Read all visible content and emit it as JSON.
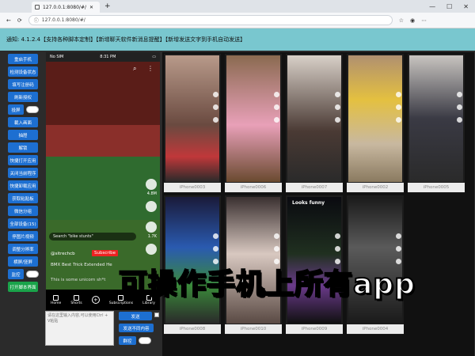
{
  "browser": {
    "tab_title": "127.0.0.1:8080/#/",
    "url": "127.0.0.1:8080/#/"
  },
  "notice": "通知: 4.1.2.4【支持各种脚本定制】【新增聊天软件新消息提醒】【新增发送文字到手机自动发送】",
  "sidebar": {
    "buttons": [
      "重启手机",
      "检测设备状态",
      "填写注册码",
      "刷新授权"
    ],
    "toggle1_label": "投屏",
    "buttons2": [
      "載入画面",
      "抽屉",
      "解锁",
      "快捷打开应用",
      "关闭当前程序",
      "快捷卸载应用",
      "获取粘贴板",
      "微信分组",
      "全部设备(15)",
      "停图片视频",
      "调整分辨率",
      "横屏/竖屏"
    ],
    "toggle2_label": "监控",
    "script_button": "打开脚本界面"
  },
  "main_phone": {
    "time": "8:31 PM",
    "signal": "No SIM",
    "search_text": "Search \"bike stunts\"",
    "user": "@sitrechcb",
    "subscribe": "Subscribe",
    "title": "BMX Best Trick Extended He",
    "desc": "This is some unicorn sh*t",
    "likes": "4.8M",
    "comments": "1.7K",
    "nav": [
      "Home",
      "Shorts",
      "",
      "Subscriptions",
      "Library"
    ]
  },
  "input": {
    "placeholder": "请在这里输入内容,可以使用Ctrl + V粘贴",
    "send": "发送",
    "send_diff": "发送不同内容",
    "group": "群控"
  },
  "phones": [
    {
      "label": "iPhone0003"
    },
    {
      "label": "iPhone0006"
    },
    {
      "label": "iPhone0007"
    },
    {
      "label": "iPhone0002"
    },
    {
      "label": "iPhone0005"
    },
    {
      "label": "iPhone0008"
    },
    {
      "label": "iPhone0010"
    },
    {
      "label": "iPhone0009",
      "looks": "Looks funny"
    },
    {
      "label": "iPhone0004"
    }
  ],
  "overlay_text": "可操作手机上所有app",
  "colors": {
    "blue": "#1d6fd1",
    "notice": "#79c7cf",
    "green": "#1aa34a",
    "red": "#e22222"
  }
}
